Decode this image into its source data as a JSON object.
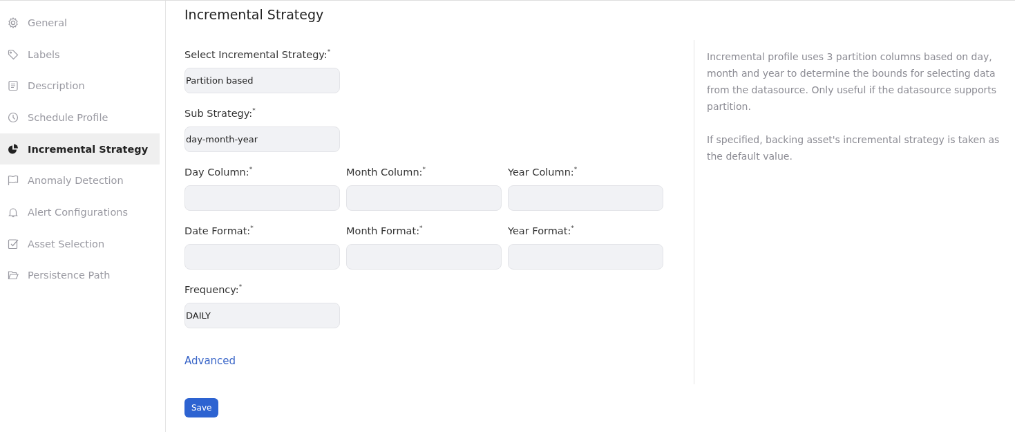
{
  "sidebar": {
    "items": [
      {
        "label": "General",
        "selected": false
      },
      {
        "label": "Labels",
        "selected": false
      },
      {
        "label": "Description",
        "selected": false
      },
      {
        "label": "Schedule Profile",
        "selected": false
      },
      {
        "label": "Incremental Strategy",
        "selected": true
      },
      {
        "label": "Anomaly Detection",
        "selected": false
      },
      {
        "label": "Alert Configurations",
        "selected": false
      },
      {
        "label": "Asset Selection",
        "selected": false
      },
      {
        "label": "Persistence Path",
        "selected": false
      }
    ]
  },
  "title": "Incremental Strategy",
  "form": {
    "rows": [
      [
        {
          "label": "Select Incremental Strategy:$^{*}$",
          "value": "Partition based"
        }
      ],
      [
        {
          "label": "Sub Strategy:$^{*}$",
          "value": "day-month-year"
        }
      ],
      [
        {
          "label": "Day Column:$^{*}$"
        },
        {
          "label": "Month Column:$^{*}$"
        },
        {
          "label": "Year Column:$^{*}$"
        }
      ],
      [
        {
          "label": "Date Format:$^{*}$"
        },
        {
          "label": "Month Format:$^{*}$"
        },
        {
          "label": "Year Format:$^{*}$"
        }
      ],
      [
        {
          "label": "Frequency:$^{*}$",
          "value": "DAILY"
        }
      ]
    ],
    "advanced_link": "Advanced",
    "save_button": "Save"
  },
  "help": {
    "paragraphs": [
      "Incremental profile uses 3 partition columns based on day, month and year to determine the bounds for selecting data from the datasource. Only useful if the datasource supports partition.",
      "If specified, backing asset's incremental strategy is taken as the default value."
    ]
  }
}
